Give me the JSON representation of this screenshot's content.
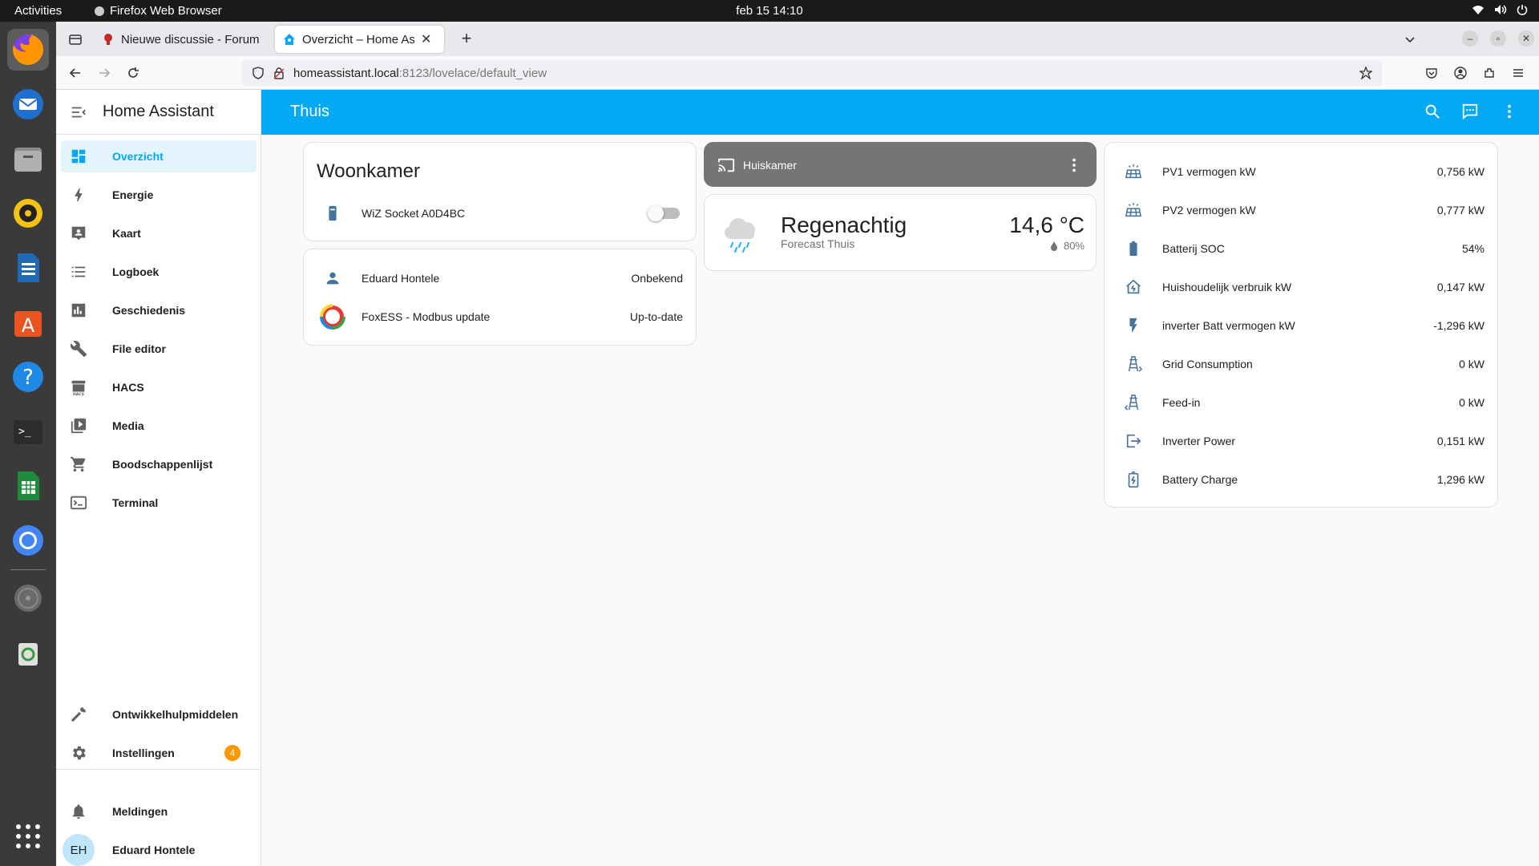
{
  "os": {
    "activities": "Activities",
    "app_name": "Firefox Web Browser",
    "clock": "feb 15  14:10"
  },
  "browser": {
    "tabs": [
      {
        "title": "Nieuwe discussie - Forum",
        "active": false
      },
      {
        "title": "Overzicht – Home Assistant",
        "active": true
      }
    ],
    "url_host": "homeassistant.local",
    "url_path": ":8123/lovelace/default_view"
  },
  "sidebar": {
    "title": "Home Assistant",
    "items": [
      {
        "label": "Overzicht",
        "icon": "dashboard-icon"
      },
      {
        "label": "Energie",
        "icon": "lightning-icon"
      },
      {
        "label": "Kaart",
        "icon": "map-icon"
      },
      {
        "label": "Logboek",
        "icon": "list-icon"
      },
      {
        "label": "Geschiedenis",
        "icon": "chart-icon"
      },
      {
        "label": "File editor",
        "icon": "wrench-icon"
      },
      {
        "label": "HACS",
        "icon": "hacs-icon"
      },
      {
        "label": "Media",
        "icon": "media-icon"
      },
      {
        "label": "Boodschappenlijst",
        "icon": "cart-icon"
      },
      {
        "label": "Terminal",
        "icon": "terminal-icon"
      }
    ],
    "dev_tools": "Ontwikkelhulpmiddelen",
    "settings": "Instellingen",
    "settings_badge": "4",
    "notifications": "Meldingen",
    "user_initials": "EH",
    "user_name": "Eduard Hontele"
  },
  "header": {
    "view_title": "Thuis"
  },
  "cards": {
    "woonkamer": {
      "title": "Woonkamer",
      "entity": "WiZ Socket A0D4BC",
      "toggle_on": false
    },
    "people": {
      "rows": [
        {
          "name": "Eduard Hontele",
          "state": "Onbekend"
        },
        {
          "name": "FoxESS - Modbus update",
          "state": "Up-to-date"
        }
      ]
    },
    "media": {
      "name": "Huiskamer"
    },
    "weather": {
      "condition": "Regenachtig",
      "subtitle": "Forecast Thuis",
      "temperature": "14,6 °C",
      "humidity": "80%"
    },
    "energy": {
      "rows": [
        {
          "name": "PV1 vermogen kW",
          "state": "0,756 kW",
          "icon": "solar-panel-icon"
        },
        {
          "name": "PV2 vermogen kW",
          "state": "0,777 kW",
          "icon": "solar-panel-icon"
        },
        {
          "name": "Batterij SOC",
          "state": "54%",
          "icon": "battery-icon"
        },
        {
          "name": "Huishoudelijk verbruik kW",
          "state": "0,147 kW",
          "icon": "home-lightning-icon"
        },
        {
          "name": "inverter Batt vermogen kW",
          "state": "-1,296 kW",
          "icon": "flash-icon"
        },
        {
          "name": "Grid Consumption",
          "state": "0 kW",
          "icon": "transmission-tower-import-icon"
        },
        {
          "name": "Feed-in",
          "state": "0 kW",
          "icon": "transmission-tower-export-icon"
        },
        {
          "name": "Inverter Power",
          "state": "0,151 kW",
          "icon": "export-icon"
        },
        {
          "name": "Battery Charge",
          "state": "1,296 kW",
          "icon": "battery-charging-icon"
        }
      ]
    }
  },
  "colors": {
    "primary": "#03a9f4",
    "state_icon": "#44739e",
    "badge": "#ff9800"
  }
}
